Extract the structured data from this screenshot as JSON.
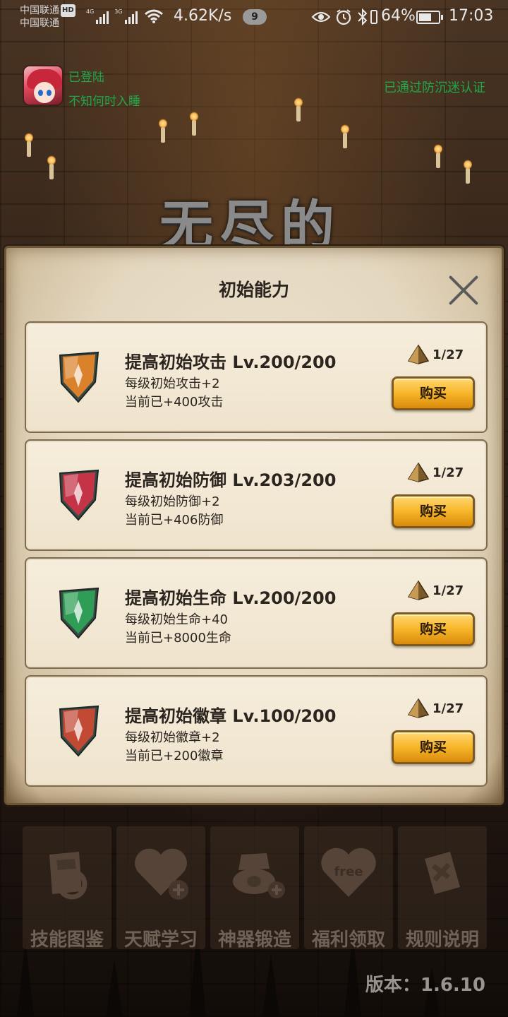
{
  "status_bar": {
    "carrier_1": "中国联通",
    "carrier_2": "中国联通",
    "hd_badge": "HD",
    "net_1": "4G",
    "net_2": "3G",
    "speed": "4.62K/s",
    "notification_count": "9",
    "battery": "64%",
    "battery_level": 0.64,
    "time": "17:03"
  },
  "login": {
    "status": "已登陆",
    "username": "不知何时入睡",
    "anti_addiction": "已通过防沉迷认证"
  },
  "game_title": "无尽的",
  "dialog": {
    "title": "初始能力",
    "items": [
      {
        "title": "提高初始攻击 Lv.200/200",
        "per_level": "每级初始攻击+2",
        "current": "当前已+400攻击",
        "cost": "1/27",
        "buy": "购买",
        "gem_color": "#d9822b"
      },
      {
        "title": "提高初始防御 Lv.203/200",
        "per_level": "每级初始防御+2",
        "current": "当前已+406防御",
        "cost": "1/27",
        "buy": "购买",
        "gem_color": "#c43346"
      },
      {
        "title": "提高初始生命 Lv.200/200",
        "per_level": "每级初始生命+40",
        "current": "当前已+8000生命",
        "cost": "1/27",
        "buy": "购买",
        "gem_color": "#2f9d55"
      },
      {
        "title": "提高初始徽章 Lv.100/200",
        "per_level": "每级初始徽章+2",
        "current": "当前已+200徽章",
        "cost": "1/27",
        "buy": "购买",
        "gem_color": "#c24a35"
      }
    ]
  },
  "menu": [
    {
      "label": "技能图鉴",
      "icon": "skill-book-icon"
    },
    {
      "label": "天赋学习",
      "icon": "heart-plus-icon"
    },
    {
      "label": "神器锻造",
      "icon": "artifact-forge-icon"
    },
    {
      "label": "福利领取",
      "icon": "free-heart-icon"
    },
    {
      "label": "规则说明",
      "icon": "rules-cards-icon"
    }
  ],
  "menu_icon_text": "free",
  "version": "版本：1.6.10"
}
